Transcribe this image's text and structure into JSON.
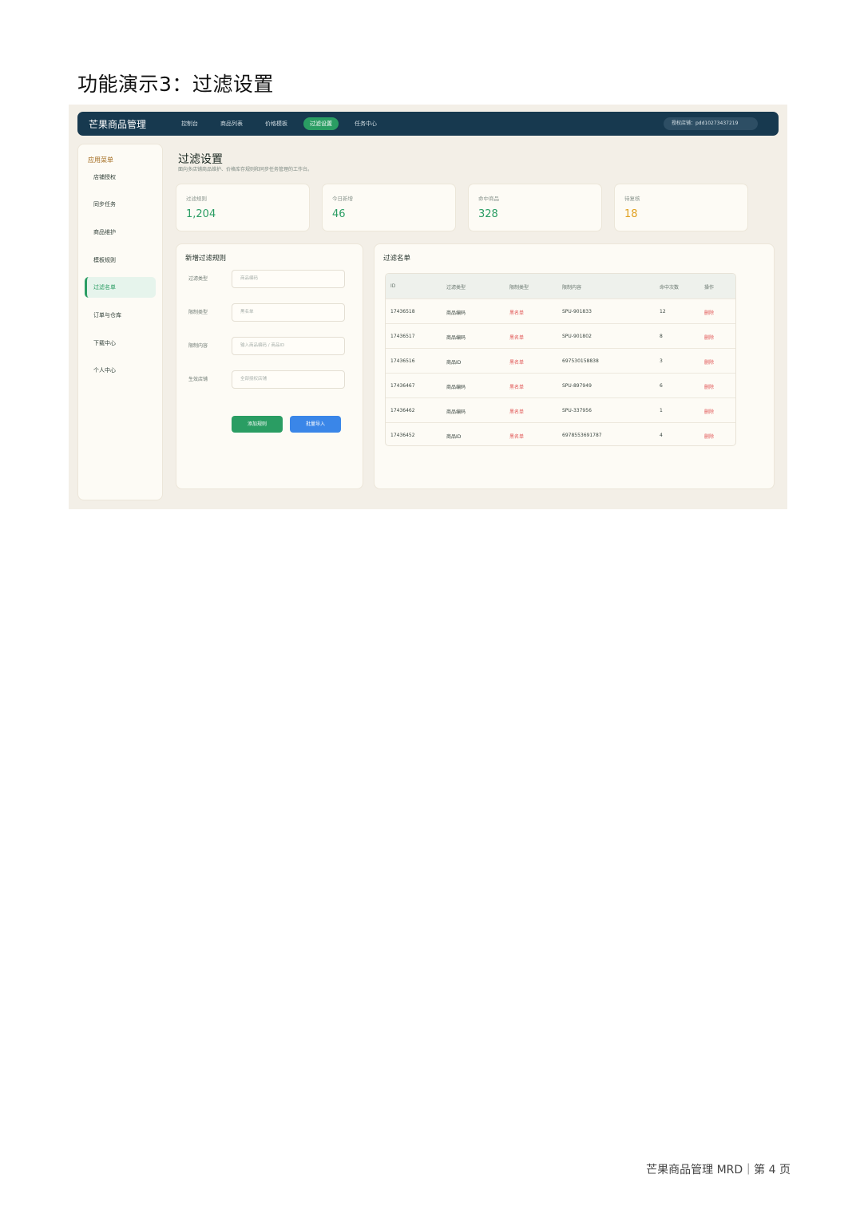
{
  "doc": {
    "heading": "功能演示3：过滤设置",
    "footer": "芒果商品管理 MRD｜第 4 页"
  },
  "colors": {
    "brand_dark": "#17394f",
    "accent_green": "#2a9d63",
    "accent_blue": "#3a86e8",
    "warning_orange": "#e0a020",
    "danger_red": "#e05252",
    "canvas": "#f3efe7"
  },
  "app": {
    "brand": "芒果商品管理",
    "nav": [
      "控制台",
      "商品列表",
      "价格模板",
      "过滤设置",
      "任务中心"
    ],
    "nav_active": "过滤设置",
    "shop_badge": "授权店铺：pdd10273437219"
  },
  "sidebar": {
    "title": "应用菜单",
    "items": [
      {
        "label": "店铺授权"
      },
      {
        "label": "同步任务"
      },
      {
        "label": "商品维护"
      },
      {
        "label": "模板规则"
      },
      {
        "label": "过滤名单"
      },
      {
        "label": "订单与仓库"
      },
      {
        "label": "下载中心"
      },
      {
        "label": "个人中心"
      }
    ],
    "active": "过滤名单"
  },
  "page": {
    "title": "过滤设置",
    "subtitle": "面向多店铺商品维护、价格库存规则和同步任务管理的工作台。"
  },
  "stats": [
    {
      "label": "过滤规则",
      "value": "1,204",
      "color": "#2a9d63"
    },
    {
      "label": "今日新增",
      "value": "46",
      "color": "#2a9d63"
    },
    {
      "label": "命中商品",
      "value": "328",
      "color": "#2a9d63"
    },
    {
      "label": "待复核",
      "value": "18",
      "color": "#e0a020"
    }
  ],
  "form": {
    "title": "新增过滤规则",
    "fields": [
      {
        "label": "过滤类型",
        "placeholder": "商品编码"
      },
      {
        "label": "限制类型",
        "placeholder": "黑名单"
      },
      {
        "label": "限制内容",
        "placeholder": "输入商品编码 / 商品ID"
      },
      {
        "label": "生效店铺",
        "placeholder": "全部授权店铺"
      }
    ],
    "add_button": "添加规则",
    "import_button": "批量导入"
  },
  "list": {
    "title": "过滤名单",
    "headers": [
      "ID",
      "过滤类型",
      "限制类型",
      "限制内容",
      "命中次数",
      "操作"
    ],
    "rows": [
      [
        "17436518",
        "商品编码",
        "黑名单",
        "SPU-901833",
        "12",
        "删除"
      ],
      [
        "17436517",
        "商品编码",
        "黑名单",
        "SPU-901802",
        "8",
        "删除"
      ],
      [
        "17436516",
        "商品ID",
        "黑名单",
        "697530158838",
        "3",
        "删除"
      ],
      [
        "17436467",
        "商品编码",
        "黑名单",
        "SPU-897949",
        "6",
        "删除"
      ],
      [
        "17436462",
        "商品编码",
        "黑名单",
        "SPU-337956",
        "1",
        "删除"
      ],
      [
        "17436452",
        "商品ID",
        "黑名单",
        "6978553691787",
        "4",
        "删除"
      ]
    ]
  }
}
